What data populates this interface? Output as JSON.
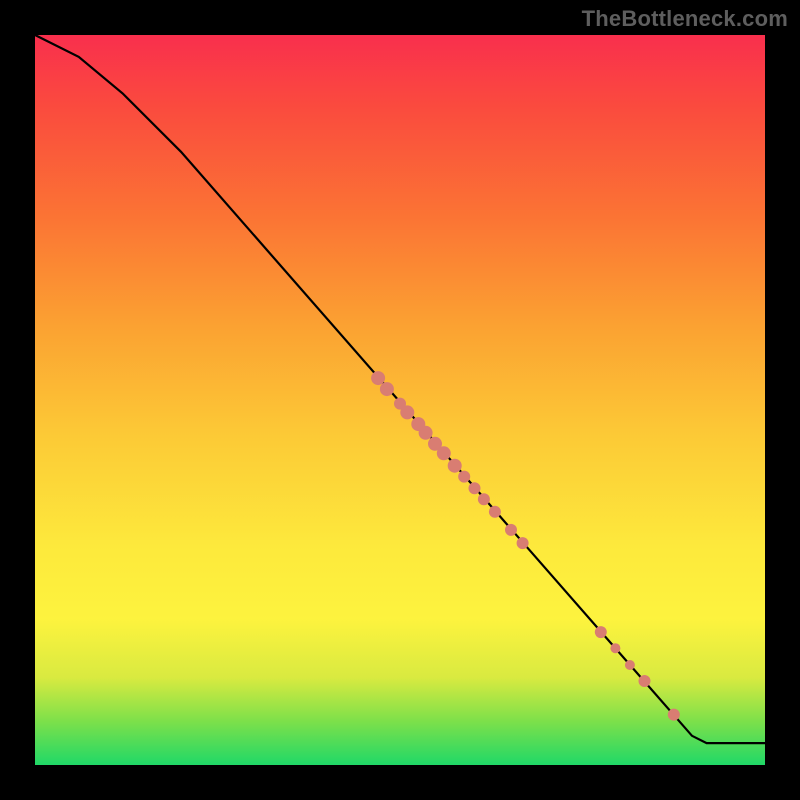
{
  "watermark": "TheBottleneck.com",
  "chart_data": {
    "type": "line",
    "title": "",
    "xlabel": "",
    "ylabel": "",
    "xlim": [
      0,
      100
    ],
    "ylim": [
      0,
      100
    ],
    "series": [
      {
        "name": "curve",
        "path": [
          {
            "x": 0,
            "y": 100
          },
          {
            "x": 6,
            "y": 97
          },
          {
            "x": 12,
            "y": 92
          },
          {
            "x": 20,
            "y": 84
          },
          {
            "x": 90,
            "y": 4
          },
          {
            "x": 92,
            "y": 3
          },
          {
            "x": 100,
            "y": 3
          }
        ]
      }
    ],
    "points": [
      {
        "x": 47.0,
        "y": 53.0,
        "r": 7
      },
      {
        "x": 48.2,
        "y": 51.5,
        "r": 7
      },
      {
        "x": 50.0,
        "y": 49.5,
        "r": 6
      },
      {
        "x": 51.0,
        "y": 48.3,
        "r": 7
      },
      {
        "x": 52.5,
        "y": 46.7,
        "r": 7
      },
      {
        "x": 53.5,
        "y": 45.5,
        "r": 7
      },
      {
        "x": 54.8,
        "y": 44.0,
        "r": 7
      },
      {
        "x": 56.0,
        "y": 42.7,
        "r": 7
      },
      {
        "x": 57.5,
        "y": 41.0,
        "r": 7
      },
      {
        "x": 58.8,
        "y": 39.5,
        "r": 6
      },
      {
        "x": 60.2,
        "y": 37.9,
        "r": 6
      },
      {
        "x": 61.5,
        "y": 36.4,
        "r": 6
      },
      {
        "x": 63.0,
        "y": 34.7,
        "r": 6
      },
      {
        "x": 65.2,
        "y": 32.2,
        "r": 6
      },
      {
        "x": 66.8,
        "y": 30.4,
        "r": 6
      },
      {
        "x": 77.5,
        "y": 18.2,
        "r": 6
      },
      {
        "x": 79.5,
        "y": 16.0,
        "r": 5
      },
      {
        "x": 81.5,
        "y": 13.7,
        "r": 5
      },
      {
        "x": 83.5,
        "y": 11.5,
        "r": 6
      },
      {
        "x": 87.5,
        "y": 6.9,
        "r": 6
      }
    ]
  }
}
